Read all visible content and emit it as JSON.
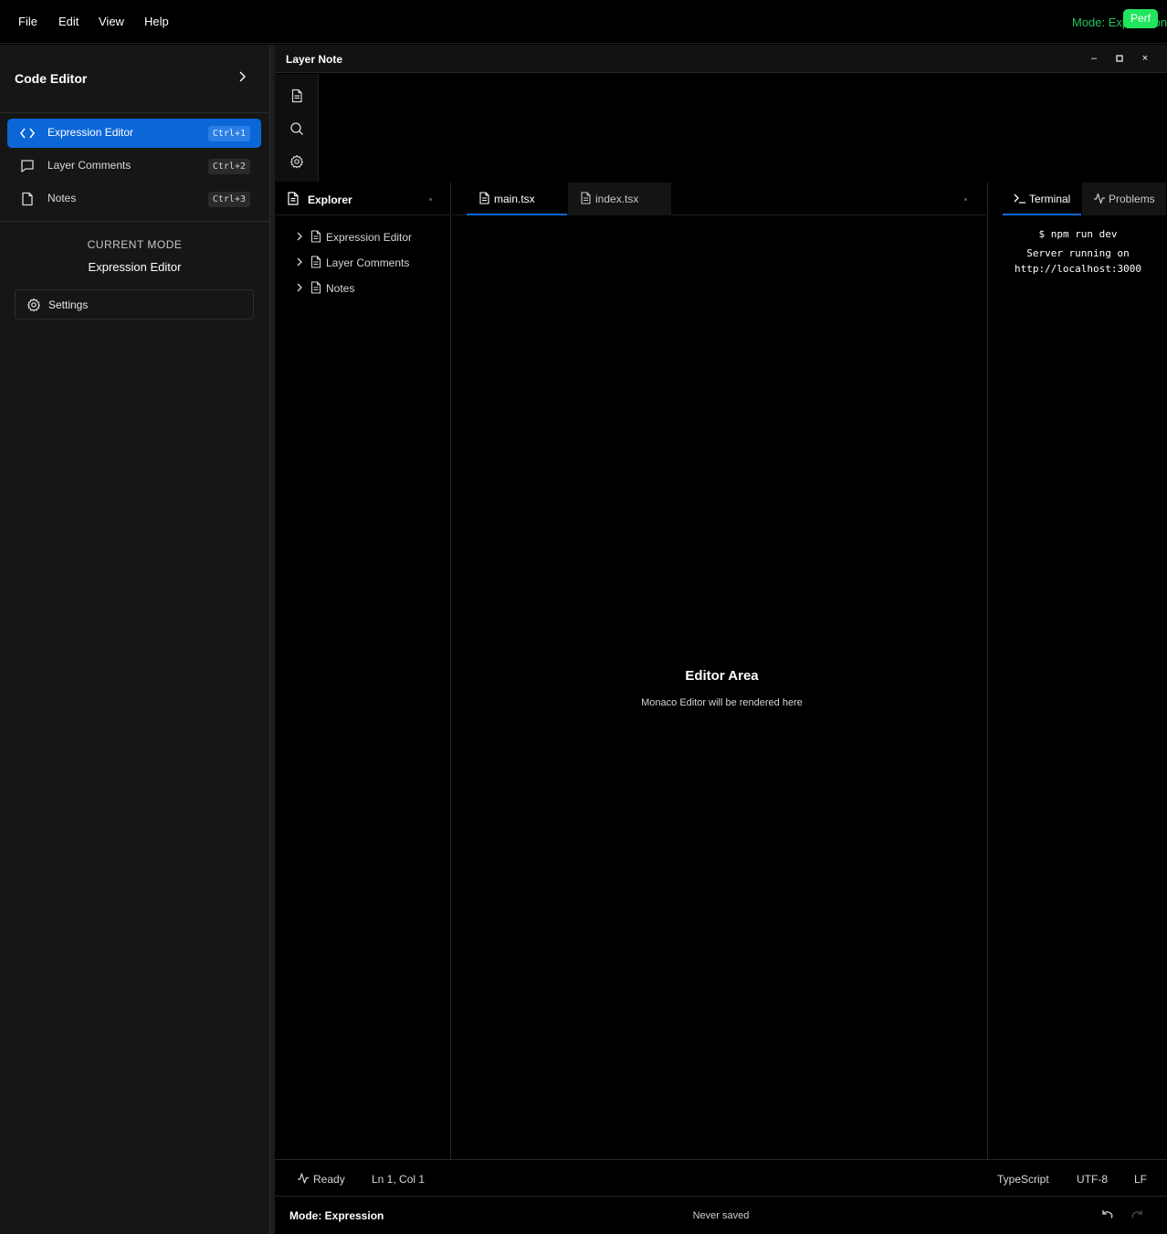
{
  "menubar": {
    "items": [
      "File",
      "Edit",
      "View",
      "Help"
    ],
    "mode_indicator": "Mode: Expression",
    "perf_badge": "Perf"
  },
  "sidebar": {
    "title": "Code Editor",
    "items": [
      {
        "label": "Expression Editor",
        "shortcut": "Ctrl+1",
        "icon": "code-icon",
        "active": true
      },
      {
        "label": "Layer Comments",
        "shortcut": "Ctrl+2",
        "icon": "comment-icon",
        "active": false
      },
      {
        "label": "Notes",
        "shortcut": "Ctrl+3",
        "icon": "note-icon",
        "active": false
      }
    ],
    "current_mode_label": "CURRENT MODE",
    "current_mode_value": "Expression Editor",
    "settings_label": "Settings"
  },
  "window": {
    "title": "Layer Note",
    "controls": {
      "minimize": "–",
      "maximize": "□",
      "close": "×"
    },
    "activity_icons": [
      "file-icon",
      "search-icon",
      "gear-icon"
    ]
  },
  "explorer": {
    "title": "Explorer",
    "items": [
      "Expression Editor",
      "Layer Comments",
      "Notes"
    ]
  },
  "editor": {
    "tabs": [
      {
        "label": "main.tsx",
        "active": true
      },
      {
        "label": "index.tsx",
        "active": false
      }
    ],
    "placeholder_title": "Editor Area",
    "placeholder_subtitle": "Monaco Editor will be rendered here"
  },
  "panel": {
    "tabs": [
      {
        "label": "Terminal",
        "icon": "terminal-icon",
        "active": true
      },
      {
        "label": "Problems",
        "icon": "activity-icon",
        "active": false
      }
    ],
    "terminal_lines": [
      "$ npm run dev",
      "Server running on",
      "http://localhost:3000"
    ]
  },
  "statusbar": {
    "status": "Ready",
    "cursor": "Ln 1, Col 1",
    "language": "TypeScript",
    "encoding": "UTF-8",
    "line_ending": "LF"
  },
  "footer": {
    "mode": "Mode: Expression",
    "saved": "Never saved"
  },
  "colors": {
    "accent": "#0b67d8",
    "mode_green": "#22c55e",
    "sidebar_bg": "#161616"
  }
}
